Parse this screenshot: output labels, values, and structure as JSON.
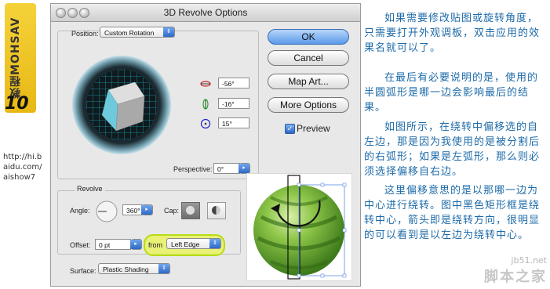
{
  "brand": {
    "vertical_text": "教程MOHSAV",
    "number": "10",
    "url": "http://hi.baidu.com/aishow7"
  },
  "dialog": {
    "title": "3D Revolve Options",
    "position": {
      "label": "Position:",
      "value": "Custom Rotation"
    },
    "rotation": {
      "x": "-56°",
      "y": "-16°",
      "z": "15°"
    },
    "perspective": {
      "label": "Perspective:",
      "value": "0°"
    },
    "buttons": {
      "ok": "OK",
      "cancel": "Cancel",
      "map_art": "Map Art...",
      "more_options": "More Options"
    },
    "preview": {
      "label": "Preview",
      "checked": true
    },
    "revolve": {
      "section": "Revolve",
      "angle_label": "Angle:",
      "angle_value": "360°",
      "cap_label": "Cap:",
      "offset_label": "Offset:",
      "offset_value": "0 pt",
      "from_label": "from",
      "from_value": "Left Edge"
    },
    "surface": {
      "label": "Surface:",
      "value": "Plastic Shading"
    }
  },
  "colors": {
    "accent": "#2e69c8",
    "text_cn": "#1e6ba8",
    "highlight": "#eaf546",
    "brand_yellow": "#f0c728"
  },
  "article": {
    "p1": "如果需要修改贴图或旋转角度，只需要打开外观调板，双击应用的效果名就可以了。",
    "p2": "在最后有必要说明的是，使用的半圆弧形是哪一边会影响最后的结果。",
    "p3": "如图所示，在绕转中偏移选的自左边，那是因为我使用的是被分割后的右弧形；如果是左弧形，那么则必须选择偏移自右边。",
    "p4": "这里偏移意思的是以那哪一边为中心进行绕转。图中黑色矩形框是绕转中心，箭头即是绕转方向，很明显的可以看到是以左边为绕转中心。"
  },
  "watermark": {
    "site": "jb51.net",
    "name": "脚本之家"
  }
}
